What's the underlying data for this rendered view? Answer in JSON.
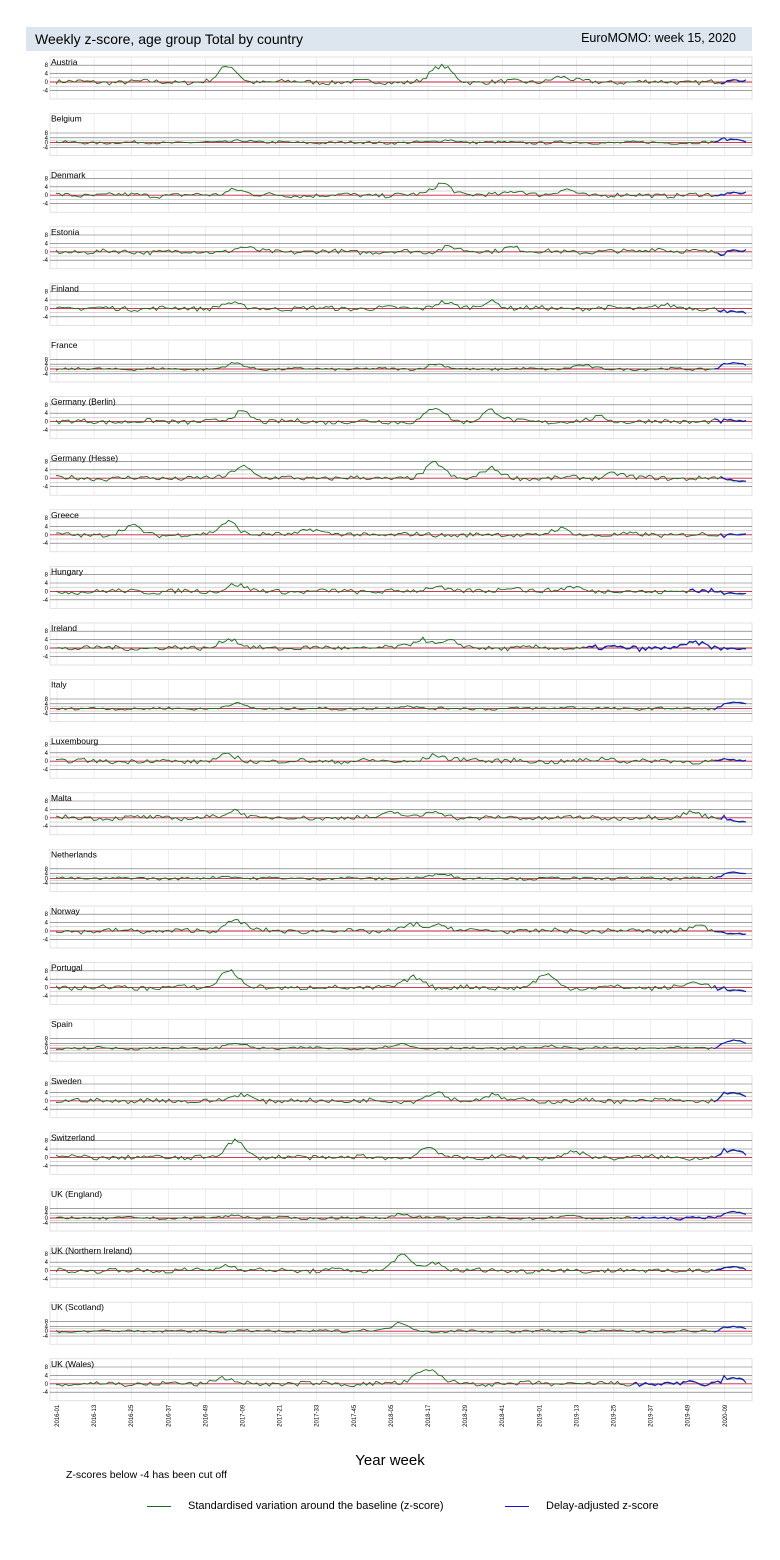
{
  "header": {
    "title": "Weekly z-score, age group Total by country",
    "source": "EuroMOMO: week 15, 2020"
  },
  "chart_data": {
    "type": "line",
    "x_label": "Year week",
    "y_tick_labels": [
      "8",
      "4",
      "0",
      "-4"
    ],
    "x_tick_labels": [
      "2016-01",
      "2016-13",
      "2016-25",
      "2016-37",
      "2016-49",
      "2017-09",
      "2017-21",
      "2017-33",
      "2017-45",
      "2018-05",
      "2018-17",
      "2018-29",
      "2018-41",
      "2019-01",
      "2019-13",
      "2019-25",
      "2019-37",
      "2019-49",
      "2020-09"
    ],
    "series_names": [
      "Standardised variation around the baseline (z-score)",
      "Delay-adjusted z-score"
    ],
    "note": "Z-scores below -4 has been cut off",
    "colors": {
      "zscore": "#1a6b1a",
      "adjusted": "#1414d4",
      "baseline": "#c81e3c",
      "grid": "#555555"
    },
    "panels": [
      {
        "country": "Austria",
        "scale": "small",
        "end": 1.0,
        "peaks": [
          [
            0.25,
            7.5
          ],
          [
            0.565,
            5.0
          ],
          [
            0.55,
            3.5
          ],
          [
            0.73,
            2.5
          ]
        ],
        "adj_start": 0.965
      },
      {
        "country": "Belgium",
        "scale": "large",
        "end": 0.5,
        "peaks": [
          [
            0.27,
            2.0
          ],
          [
            0.57,
            2.5
          ],
          [
            0.985,
            8.0
          ]
        ],
        "adj_start": 0.955
      },
      {
        "country": "Denmark",
        "scale": "small",
        "end": 1.5,
        "peaks": [
          [
            0.26,
            3.0
          ],
          [
            0.56,
            6.0
          ],
          [
            0.67,
            2.5
          ],
          [
            0.74,
            2.5
          ]
        ],
        "adj_start": 0.955
      },
      {
        "country": "Estonia",
        "scale": "small",
        "end": 1.0,
        "peaks": [
          [
            0.27,
            2.0
          ],
          [
            0.57,
            2.5
          ],
          [
            0.66,
            2.5
          ],
          [
            0.87,
            2.0
          ]
        ],
        "adj_start": 0.96
      },
      {
        "country": "Finland",
        "scale": "small",
        "end": -2.5,
        "peaks": [
          [
            0.25,
            2.5
          ],
          [
            0.56,
            3.0
          ],
          [
            0.63,
            3.5
          ],
          [
            0.88,
            1.5
          ]
        ],
        "adj_start": 0.96
      },
      {
        "country": "France",
        "scale": "large",
        "end": 3.0,
        "peaks": [
          [
            0.26,
            4.5
          ],
          [
            0.55,
            4.0
          ],
          [
            0.76,
            3.0
          ],
          [
            0.985,
            10.0
          ]
        ],
        "adj_start": 0.955
      },
      {
        "country": "Germany (Berlin)",
        "scale": "small",
        "end": 0.5,
        "peaks": [
          [
            0.27,
            4.5
          ],
          [
            0.55,
            6.5
          ],
          [
            0.63,
            5.5
          ],
          [
            0.79,
            2.0
          ]
        ],
        "adj_start": 0.955
      },
      {
        "country": "Germany (Hesse)",
        "scale": "small",
        "end": -1.5,
        "peaks": [
          [
            0.27,
            6.0
          ],
          [
            0.55,
            7.0
          ],
          [
            0.63,
            4.5
          ],
          [
            0.81,
            2.5
          ]
        ],
        "adj_start": 0.965
      },
      {
        "country": "Greece",
        "scale": "small",
        "end": 0.5,
        "peaks": [
          [
            0.11,
            4.0
          ],
          [
            0.25,
            6.5
          ],
          [
            0.37,
            3.0
          ],
          [
            0.73,
            2.5
          ]
        ],
        "adj_start": 0.965
      },
      {
        "country": "Hungary",
        "scale": "small",
        "end": -1.0,
        "peaks": [
          [
            0.26,
            3.5
          ],
          [
            0.55,
            2.5
          ],
          [
            0.66,
            2.5
          ],
          [
            0.75,
            2.5
          ]
        ],
        "adj_start": 0.92
      },
      {
        "country": "Ireland",
        "scale": "small",
        "end": -0.5,
        "peaks": [
          [
            0.25,
            4.5
          ],
          [
            0.53,
            4.5
          ],
          [
            0.57,
            3.0
          ],
          [
            0.93,
            2.5
          ]
        ],
        "adj_start": 0.77
      },
      {
        "country": "Italy",
        "scale": "large",
        "end": 4.0,
        "peaks": [
          [
            0.26,
            4.0
          ],
          [
            0.51,
            2.5
          ],
          [
            0.74,
            1.5
          ],
          [
            0.985,
            8.0
          ]
        ],
        "adj_start": 0.955
      },
      {
        "country": "Luxembourg",
        "scale": "small",
        "end": 0.5,
        "peaks": [
          [
            0.25,
            2.5
          ],
          [
            0.55,
            2.5
          ],
          [
            0.6,
            1.5
          ],
          [
            0.8,
            1.5
          ]
        ],
        "adj_start": 0.955
      },
      {
        "country": "Malta",
        "scale": "small",
        "end": -2.0,
        "peaks": [
          [
            0.26,
            3.5
          ],
          [
            0.49,
            3.0
          ],
          [
            0.55,
            3.0
          ],
          [
            0.92,
            3.0
          ]
        ],
        "adj_start": 0.965
      },
      {
        "country": "Netherlands",
        "scale": "large",
        "end": 4.0,
        "peaks": [
          [
            0.25,
            2.0
          ],
          [
            0.56,
            4.5
          ],
          [
            0.985,
            8.0
          ]
        ],
        "adj_start": 0.955
      },
      {
        "country": "Norway",
        "scale": "small",
        "end": -1.5,
        "peaks": [
          [
            0.26,
            5.5
          ],
          [
            0.52,
            3.0
          ],
          [
            0.56,
            3.0
          ],
          [
            0.93,
            2.0
          ]
        ],
        "adj_start": 0.955
      },
      {
        "country": "Portugal",
        "scale": "small",
        "end": -2.0,
        "peaks": [
          [
            0.25,
            8.5
          ],
          [
            0.52,
            5.0
          ],
          [
            0.71,
            6.0
          ],
          [
            0.93,
            2.5
          ]
        ],
        "adj_start": 0.955
      },
      {
        "country": "Spain",
        "scale": "large",
        "end": 4.0,
        "peaks": [
          [
            0.26,
            4.0
          ],
          [
            0.5,
            3.5
          ],
          [
            0.72,
            2.0
          ],
          [
            0.985,
            12.0
          ]
        ],
        "adj_start": 0.955
      },
      {
        "country": "Sweden",
        "scale": "small",
        "end": 2.0,
        "peaks": [
          [
            0.27,
            3.0
          ],
          [
            0.55,
            4.0
          ],
          [
            0.63,
            3.0
          ],
          [
            0.985,
            7.5
          ]
        ],
        "adj_start": 0.955
      },
      {
        "country": "Switzerland",
        "scale": "small",
        "end": 1.0,
        "peaks": [
          [
            0.26,
            8.0
          ],
          [
            0.54,
            4.5
          ],
          [
            0.75,
            2.5
          ],
          [
            0.985,
            8.5
          ]
        ],
        "adj_start": 0.955
      },
      {
        "country": "UK (England)",
        "scale": "large",
        "end": 3.0,
        "peaks": [
          [
            0.26,
            2.5
          ],
          [
            0.5,
            3.5
          ],
          [
            0.74,
            1.5
          ],
          [
            0.985,
            10.0
          ]
        ],
        "adj_start": 0.84
      },
      {
        "country": "UK (Northern Ireland)",
        "scale": "small",
        "end": 0.5,
        "peaks": [
          [
            0.25,
            3.0
          ],
          [
            0.5,
            7.0
          ],
          [
            0.55,
            4.0
          ],
          [
            0.985,
            5.0
          ]
        ],
        "adj_start": 0.955
      },
      {
        "country": "UK (Scotland)",
        "scale": "large",
        "end": 2.0,
        "peaks": [
          [
            0.5,
            6.5
          ],
          [
            0.45,
            1.5
          ],
          [
            0.985,
            8.0
          ]
        ],
        "adj_start": 0.955
      },
      {
        "country": "UK (Wales)",
        "scale": "small",
        "end": 0.5,
        "peaks": [
          [
            0.24,
            3.0
          ],
          [
            0.53,
            5.0
          ],
          [
            0.55,
            4.0
          ],
          [
            0.985,
            8.0
          ]
        ],
        "adj_start": 0.84
      }
    ]
  }
}
